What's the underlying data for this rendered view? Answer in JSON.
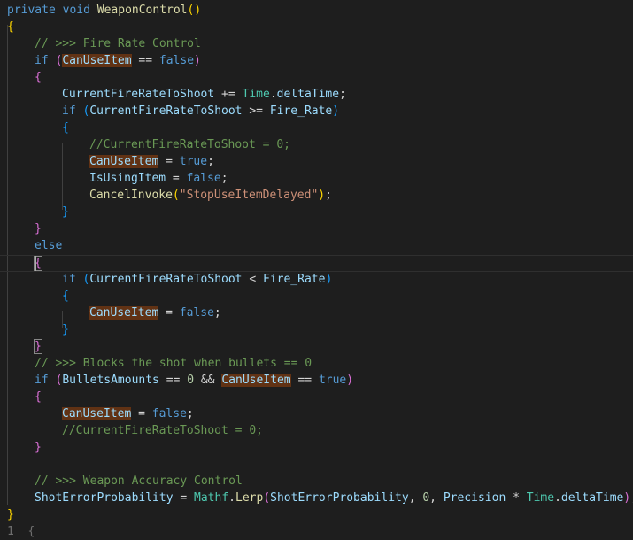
{
  "code": {
    "l1": {
      "kw": "private",
      "kw2": "void",
      "fn": "WeaponControl",
      "paren": "()"
    },
    "l2": {
      "brace": "{"
    },
    "l3": {
      "comment": "// >>> Fire Rate Control"
    },
    "l4": {
      "kw": "if",
      "open": "(",
      "var": "CanUseItem",
      "op": " == ",
      "val": "false",
      "close": ")"
    },
    "l5": {
      "brace": "{"
    },
    "l6": {
      "var": "CurrentFireRateToShoot",
      "op": " += ",
      "type": "Time",
      "dot": ".",
      "prop": "deltaTime",
      "end": ";"
    },
    "l7": {
      "kw": "if",
      "open": "(",
      "var": "CurrentFireRateToShoot",
      "op": " >= ",
      "var2": "Fire_Rate",
      "close": ")"
    },
    "l8": {
      "brace": "{"
    },
    "l9": {
      "comment": "//CurrentFireRateToShoot = 0;"
    },
    "l10": {
      "var": "CanUseItem",
      "op": " = ",
      "val": "true",
      "end": ";"
    },
    "l11": {
      "var": "IsUsingItem",
      "op": " = ",
      "val": "false",
      "end": ";"
    },
    "l12": {
      "fn": "CancelInvoke",
      "open": "(",
      "str": "\"StopUseItemDelayed\"",
      "close": ")",
      "end": ";"
    },
    "l13": {
      "brace": "}"
    },
    "l14": {
      "brace": "}"
    },
    "l15": {
      "kw": "else"
    },
    "l16": {
      "brace": "{"
    },
    "l17": {
      "kw": "if",
      "open": "(",
      "var": "CurrentFireRateToShoot",
      "op": " < ",
      "var2": "Fire_Rate",
      "close": ")"
    },
    "l18": {
      "brace": "{"
    },
    "l19": {
      "var": "CanUseItem",
      "op": " = ",
      "val": "false",
      "end": ";"
    },
    "l20": {
      "brace": "}"
    },
    "l21": {
      "brace": "}"
    },
    "l22": {
      "comment": "// >>> Blocks the shot when bullets == 0"
    },
    "l23": {
      "kw": "if",
      "open": "(",
      "var": "BulletsAmounts",
      "op": " == ",
      "num": "0",
      "op2": " && ",
      "var2": "CanUseItem",
      "op3": " == ",
      "val": "true",
      "close": ")"
    },
    "l24": {
      "brace": "{"
    },
    "l25": {
      "var": "CanUseItem",
      "op": " = ",
      "val": "false",
      "end": ";"
    },
    "l26": {
      "comment": "//CurrentFireRateToShoot = 0;"
    },
    "l27": {
      "brace": "}"
    },
    "l29": {
      "comment": "// >>> Weapon Accuracy Control"
    },
    "l30": {
      "var": "ShotErrorProbability",
      "op": " = ",
      "type": "Mathf",
      "dot": ".",
      "fn": "Lerp",
      "open": "(",
      "arg1": "ShotErrorProbability",
      "sep1": ", ",
      "num": "0",
      "sep2": ", ",
      "arg3": "Precision",
      "mul": " * ",
      "type2": "Time",
      "dot2": ".",
      "prop": "deltaTime",
      "close": ")",
      "end": ";"
    },
    "l31": {
      "brace": "}"
    },
    "l32": {
      "partial": "1  {"
    }
  },
  "colors": {
    "background": "#1e1e1e",
    "keyword": "#569cd6",
    "function": "#dcdcaa",
    "type": "#4ec9b0",
    "variable": "#9cdcfe",
    "comment": "#6a9955",
    "string": "#ce9178",
    "number": "#b5cea8",
    "bracket_level_1": "#ffd700",
    "bracket_level_2": "#da70d6",
    "bracket_level_3": "#179fff",
    "selection_highlight": "#613214"
  }
}
